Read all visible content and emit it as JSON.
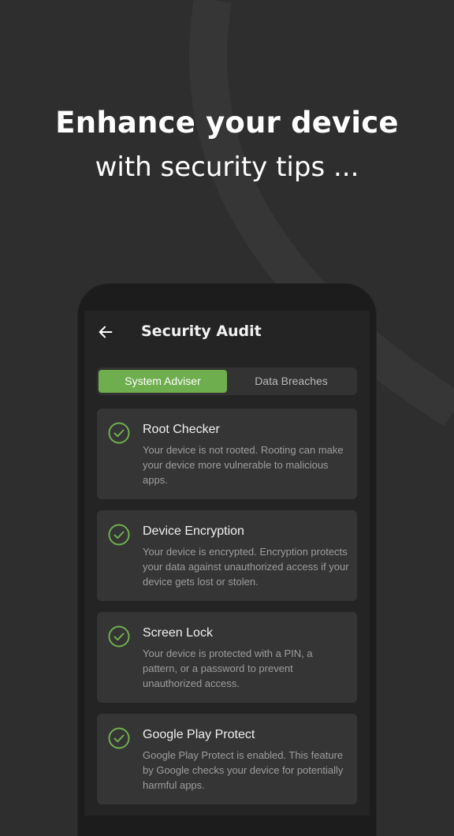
{
  "headline": {
    "line1": "Enhance your device",
    "line2": "with security tips ..."
  },
  "app": {
    "title": "Security Audit",
    "back_icon": "arrow-left-icon"
  },
  "tabs": [
    {
      "label": "System Adviser",
      "active": true
    },
    {
      "label": "Data Breaches",
      "active": false
    }
  ],
  "cards": [
    {
      "title": "Root Checker",
      "description": "Your device is not rooted. Rooting can make your device more vulnerable to malicious apps.",
      "icon": "check-circle-icon"
    },
    {
      "title": "Device Encryption",
      "description": "Your device is encrypted. Encryption protects your data against unauthorized access if your device gets lost or stolen.",
      "icon": "check-circle-icon"
    },
    {
      "title": "Screen Lock",
      "description": "Your device is protected with a PIN, a pattern, or a password to prevent unauthorized access.",
      "icon": "check-circle-icon"
    },
    {
      "title": "Google Play Protect",
      "description": "Google Play Protect is enabled. This feature by Google checks your device for potentially harmful apps.",
      "icon": "check-circle-icon"
    }
  ],
  "colors": {
    "background": "#2e2e2e",
    "accent": "#6fae4e",
    "card": "#353535",
    "screen": "#242424"
  }
}
